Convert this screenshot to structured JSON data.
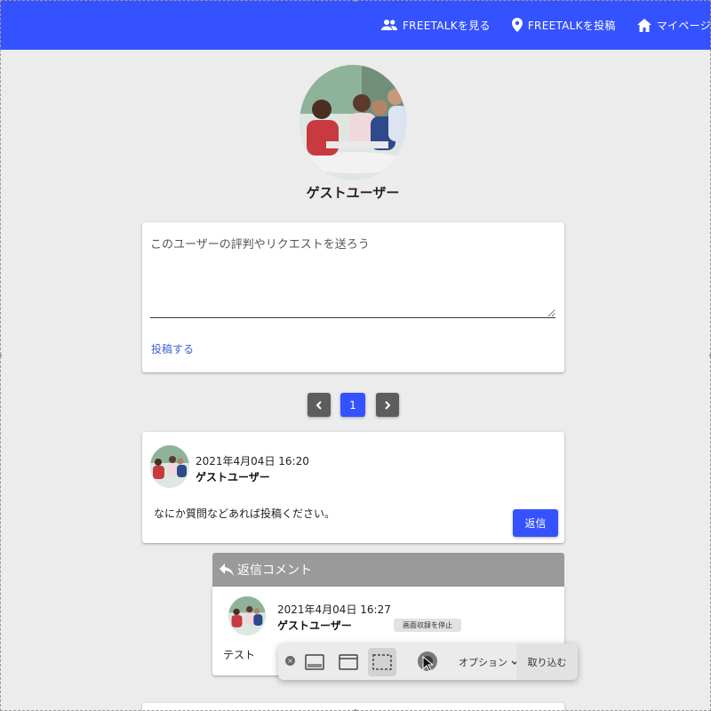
{
  "header": {
    "nav": [
      {
        "label": "FREETALKを見る",
        "icon": "people-icon"
      },
      {
        "label": "FREETALKを投稿",
        "icon": "location-pin-icon"
      },
      {
        "label": "マイページ",
        "icon": "home-icon"
      }
    ],
    "background": "#3452ff"
  },
  "profile": {
    "name": "ゲストユーザー",
    "avatar": "group-photo"
  },
  "post_form": {
    "placeholder": "このユーザーの評判やリクエストを送ろう",
    "value": "",
    "submit_label": "投稿する"
  },
  "pagination": {
    "prev": "previous-page",
    "current": "1",
    "next": "next-page"
  },
  "comment": {
    "date": "2021年4月04日 16:20",
    "author": "ゲストユーザー",
    "text": "なにか質問などあれば投稿ください。",
    "reply_label": "返信"
  },
  "reply_section": {
    "title": "返信コメント",
    "date": "2021年4月04日 16:27",
    "author": "ゲストユーザー",
    "text": "テスト"
  },
  "capture_toolbar": {
    "stop_recording_label": "画面収録を停止",
    "options_label": "オプション",
    "capture_label": "取り込む"
  },
  "colors": {
    "accent": "#3452ff",
    "page_bg": "#ececec",
    "reply_header_bg": "#9b9a9b"
  }
}
